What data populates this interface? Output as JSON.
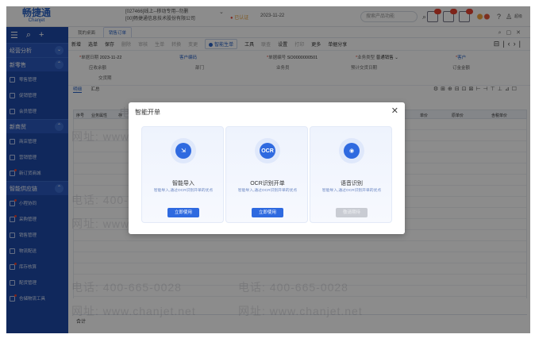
{
  "app": {
    "logo": "畅捷通",
    "logo_sub": "Chanjet",
    "company_line1": "[027466]线上--移动专用--勿删",
    "company_line2": "[00]畅捷通信息技术股份有限公司",
    "notice_label": "已认证",
    "notice_date": "2023-11-22",
    "search_placeholder": "搜索产品功能",
    "user_name": "超级"
  },
  "sidebar": {
    "sections": [
      {
        "label": "经营分析",
        "items": []
      },
      {
        "label": "新零售",
        "items": [
          "零售管理",
          "促销管理",
          "会员管理"
        ]
      },
      {
        "label": "新商贸",
        "items": [
          "商店管理",
          "营销管理",
          "新订货商城"
        ]
      },
      {
        "label": "智能供应链",
        "items": [
          "小程协同",
          "采购管理",
          "销售管理",
          "物流配送",
          "库存核算",
          "配货管理",
          "仓储物流工具"
        ]
      }
    ]
  },
  "main": {
    "tabs": [
      "我的桌面",
      "销售订单"
    ],
    "toolbar": [
      "新增",
      "选单",
      "保存",
      "删除",
      "审核",
      "生单",
      "转换",
      "变更"
    ],
    "smart_button": "智能生单",
    "toolbar2": [
      "工具",
      "联查",
      "设置",
      "打印",
      "更多"
    ],
    "share": "单据分享",
    "form": {
      "date_label": "单据日期",
      "date_value": "2023-11-22",
      "customer_code_label": "客户编码",
      "no_label": "单据编号",
      "no_value": "SO0000000501",
      "biz_type_label": "业务类型",
      "biz_type_value": "普通销售",
      "customer_label": "客户",
      "settle_label": "应收余额",
      "dept_label": "部门",
      "salesman_label": "业务员",
      "delivery_label": "预计交货日期",
      "order_amount_label": "订金金额",
      "ship_label": "交货期"
    },
    "subtabs": [
      "明细",
      "汇总"
    ],
    "columns": [
      "序号",
      "业务属性",
      "存",
      "单价",
      "原单价",
      "含税单价"
    ],
    "footer": "合计"
  },
  "modal": {
    "title": "智能开单",
    "cards": [
      {
        "icon": "import-icon",
        "glyph": "⇲",
        "title": "智能导入",
        "desc": "智能导入,通过OCR识别开单的优点",
        "button": "立即使用",
        "enabled": true
      },
      {
        "icon": "ocr-icon",
        "glyph": "OCR",
        "title": "OCR识别开单",
        "desc": "智能导入,通过OCR识别开单的优点",
        "button": "立即使用",
        "enabled": true
      },
      {
        "icon": "microphone-icon",
        "glyph": "◉",
        "title": "语音识别",
        "desc": "智能导入,通过OCR识别开单的优点",
        "button": "敬请期待",
        "enabled": false
      }
    ]
  },
  "watermark": {
    "phone": "电话: 400-665-0028",
    "site": "网址: www.chanjet.net"
  }
}
